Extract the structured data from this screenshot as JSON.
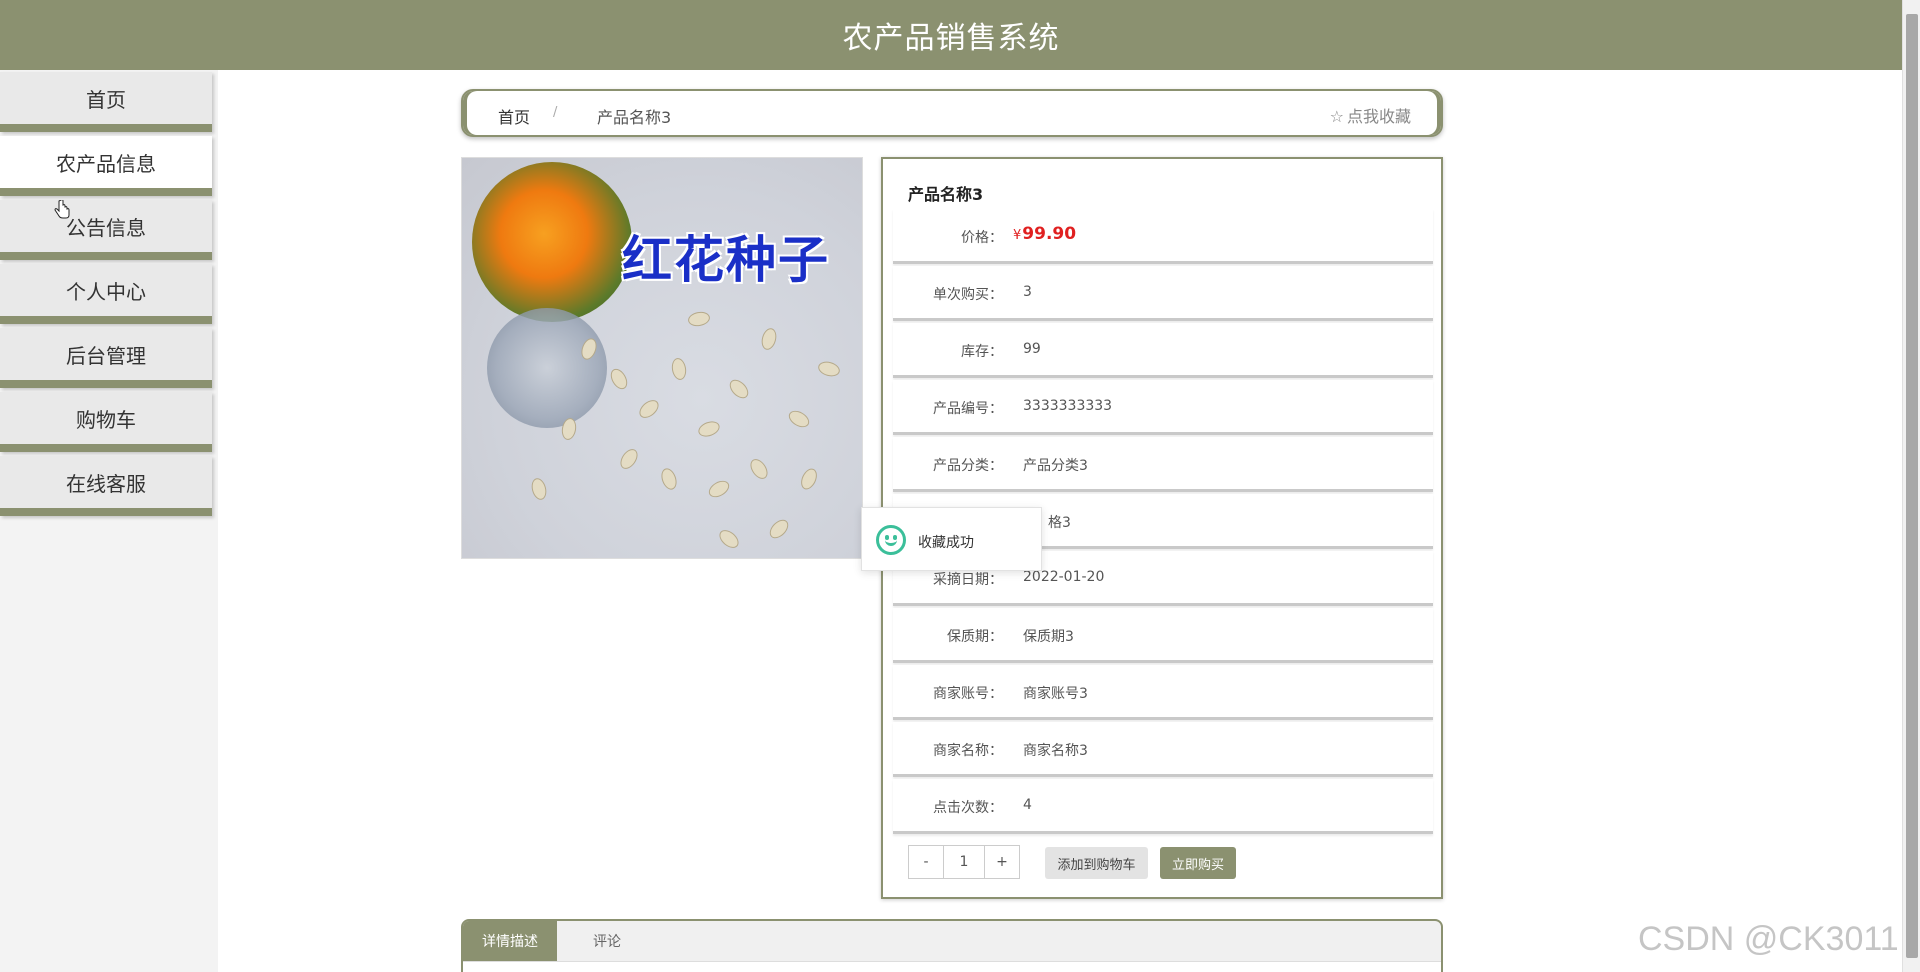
{
  "app": {
    "title": "农产品销售系统"
  },
  "sidebar": {
    "items": [
      {
        "label": "首页"
      },
      {
        "label": "农产品信息"
      },
      {
        "label": "公告信息"
      },
      {
        "label": "个人中心"
      },
      {
        "label": "后台管理"
      },
      {
        "label": "购物车"
      },
      {
        "label": "在线客服"
      }
    ],
    "active_index": 1
  },
  "breadcrumb": {
    "home": "首页",
    "separator": "/",
    "current": "产品名称3",
    "collect_label": "点我收藏",
    "collect_icon": "star-outline-icon"
  },
  "product": {
    "image_caption": "红花种子",
    "name": "产品名称3",
    "price_currency": "¥",
    "price": "99.90",
    "rows": [
      {
        "label": "单次购买：",
        "value": "3"
      },
      {
        "label": "库存：",
        "value": "99"
      },
      {
        "label": "产品编号：",
        "value": "3333333333"
      },
      {
        "label": "产品分类：",
        "value": "产品分类3"
      },
      {
        "label": "",
        "value": "格3"
      },
      {
        "label": "采摘日期：",
        "value": "2022-01-20"
      },
      {
        "label": "保质期：",
        "value": "保质期3"
      },
      {
        "label": "商家账号：",
        "value": "商家账号3"
      },
      {
        "label": "商家名称：",
        "value": "商家名称3"
      },
      {
        "label": "点击次数：",
        "value": "4"
      }
    ],
    "price_label": "价格："
  },
  "purchase": {
    "minus": "-",
    "quantity": "1",
    "plus": "+",
    "add_to_cart": "添加到购物车",
    "buy_now": "立即购买"
  },
  "toast": {
    "message": "收藏成功",
    "icon": "smile-icon"
  },
  "tabs": [
    {
      "label": "详情描述"
    },
    {
      "label": "评论"
    }
  ],
  "watermark": "CSDN @CK3011",
  "colors": {
    "accent": "#8b9170",
    "price": "#e02020",
    "toast_icon": "#3bbf9a"
  }
}
